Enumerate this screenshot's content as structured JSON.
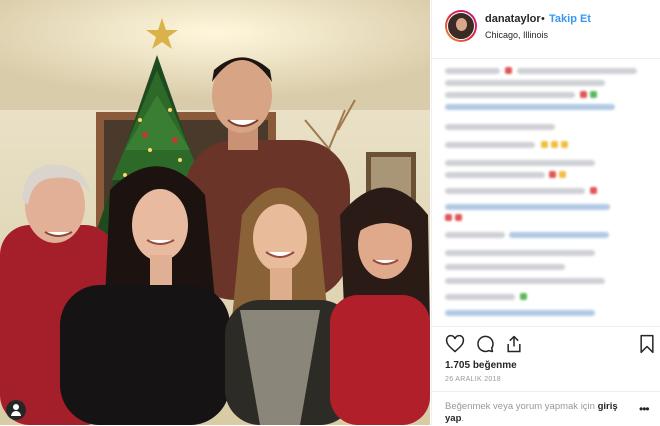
{
  "post": {
    "username": "danataylor",
    "separator": "•",
    "follow_label": "Takip Et",
    "location": "Chicago, Illinois",
    "likes_count": "1.705",
    "likes_label": "beğenme",
    "date": "26 ARALIK 2018",
    "login_prompt": "Beğenmek veya yorum yapmak için",
    "login_link": "giriş yap",
    "login_suffix": ".",
    "more_label": "•••"
  },
  "icons": {
    "like": "heart-icon",
    "comment": "comment-icon",
    "share": "share-icon",
    "save": "bookmark-icon",
    "tagged_user": "user-tag-icon"
  },
  "colors": {
    "link_blue": "#3897f0",
    "text_dark": "#262626",
    "text_muted": "#999999",
    "border": "#efefef"
  }
}
